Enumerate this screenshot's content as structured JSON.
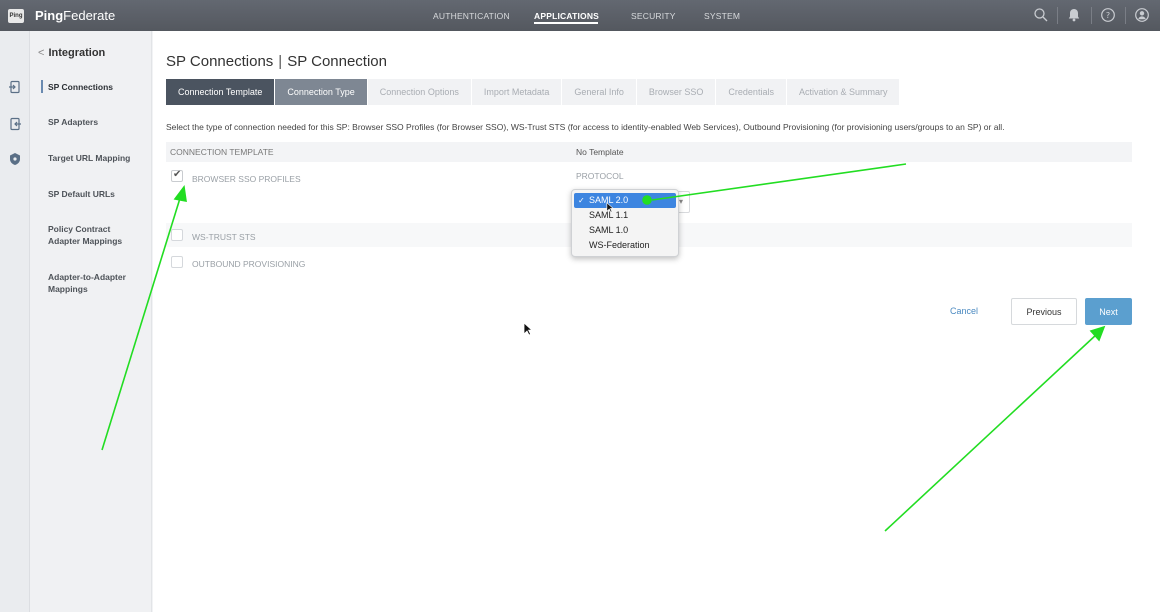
{
  "topbar": {
    "brand_bold": "Ping",
    "brand_rest": "Federate",
    "logo_text": "Ping",
    "nav": [
      "AUTHENTICATION",
      "APPLICATIONS",
      "SECURITY",
      "SYSTEM"
    ],
    "active_nav": "APPLICATIONS"
  },
  "sidebar": {
    "back_label": "Integration",
    "items": [
      {
        "label": "SP Connections",
        "active": true
      },
      {
        "label": "SP Adapters"
      },
      {
        "label": "Target URL Mapping"
      },
      {
        "label": "SP Default URLs"
      },
      {
        "label": "Policy Contract Adapter Mappings"
      },
      {
        "label": "Adapter-to-Adapter Mappings"
      }
    ]
  },
  "page": {
    "title_main": "SP Connections",
    "title_sub": "SP Connection",
    "tabs": [
      "Connection Template",
      "Connection Type",
      "Connection Options",
      "Import Metadata",
      "General Info",
      "Browser SSO",
      "Credentials",
      "Activation & Summary"
    ],
    "description": "Select the type of connection needed for this SP: Browser SSO Profiles (for Browser SSO), WS-Trust STS (for access to identity-enabled Web Services), Outbound Provisioning (for provisioning users/groups to an SP) or all."
  },
  "grid": {
    "header_left": "CONNECTION TEMPLATE",
    "header_right": "No Template",
    "rows": [
      {
        "label": "BROWSER SSO PROFILES",
        "checked": true,
        "right": "PROTOCOL"
      },
      {
        "label": "WS-TRUST STS",
        "checked": false
      },
      {
        "label": "OUTBOUND PROVISIONING",
        "checked": false
      }
    ]
  },
  "protocol_dropdown": {
    "options": [
      "SAML 2.0",
      "SAML 1.1",
      "SAML 1.0",
      "WS-Federation"
    ],
    "selected": "SAML 2.0"
  },
  "buttons": {
    "cancel": "Cancel",
    "previous": "Previous",
    "next": "Next"
  },
  "colors": {
    "topbar": "#5b6068",
    "tab_active": "#4b5460",
    "tab_current": "#7e8793",
    "next_button": "#5b9fcf",
    "annotation": "#22dd22",
    "dropdown_selected": "#3d85e0"
  }
}
